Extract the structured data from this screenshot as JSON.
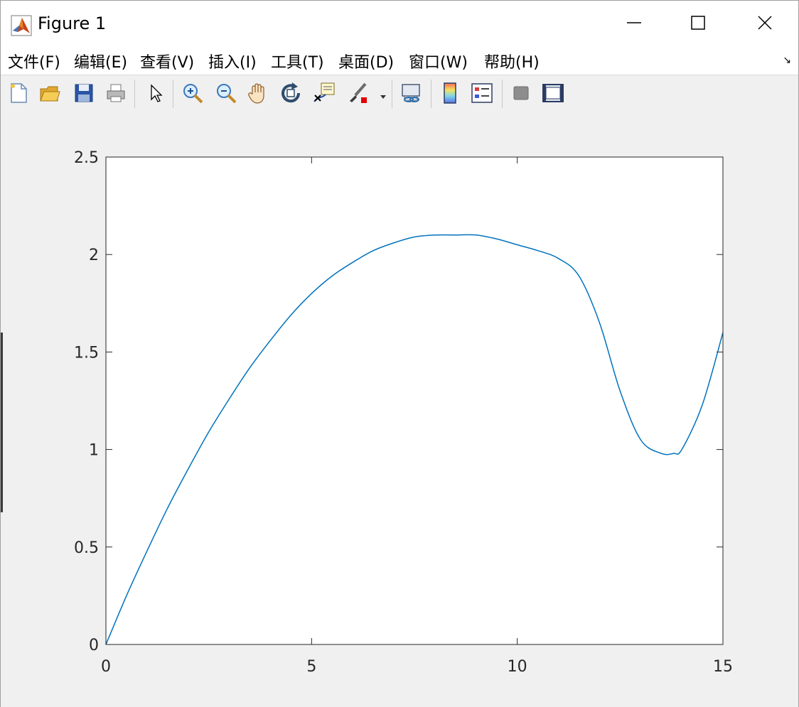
{
  "window": {
    "title": "Figure 1",
    "controls": [
      "minimize-icon",
      "maximize-icon",
      "close-icon"
    ]
  },
  "menu": {
    "items": [
      "文件(F)",
      "编辑(E)",
      "查看(V)",
      "插入(I)",
      "工具(T)",
      "桌面(D)",
      "窗口(W)",
      "帮助(H)"
    ]
  },
  "toolbar": {
    "icons": [
      "new-figure-icon",
      "open-file-icon",
      "save-icon",
      "print-icon",
      "edit-plot-arrow-icon",
      "zoom-in-icon",
      "zoom-out-icon",
      "pan-hand-icon",
      "rotate-3d-icon",
      "data-cursor-icon",
      "brush-icon",
      "link-plot-icon",
      "colorbar-icon",
      "legend-icon",
      "hide-plot-tools-icon",
      "show-plot-tools-icon"
    ]
  },
  "chart_data": {
    "type": "line",
    "title": "",
    "xlabel": "",
    "ylabel": "",
    "xlim": [
      0,
      15
    ],
    "ylim": [
      0,
      2.5
    ],
    "xticks": [
      "0",
      "5",
      "10",
      "15"
    ],
    "yticks": [
      "0",
      "0.5",
      "1",
      "1.5",
      "2",
      "2.5"
    ],
    "grid": false,
    "line_color": "#0072bd",
    "series": [
      {
        "x": [
          0,
          0.5,
          1,
          1.5,
          2,
          2.5,
          3,
          3.5,
          4,
          4.5,
          5,
          5.5,
          6,
          6.5,
          7,
          7.5,
          8,
          8.5,
          9,
          9.5,
          10,
          10.5,
          11,
          11.5,
          12,
          12.5,
          13,
          13.5,
          13.8,
          14,
          14.5,
          15
        ],
        "y": [
          0,
          0.25,
          0.48,
          0.7,
          0.9,
          1.09,
          1.26,
          1.42,
          1.56,
          1.69,
          1.8,
          1.89,
          1.96,
          2.02,
          2.06,
          2.09,
          2.1,
          2.1,
          2.1,
          2.08,
          2.05,
          2.02,
          1.98,
          1.89,
          1.65,
          1.3,
          1.05,
          0.98,
          0.98,
          1.0,
          1.23,
          1.6
        ]
      }
    ]
  }
}
